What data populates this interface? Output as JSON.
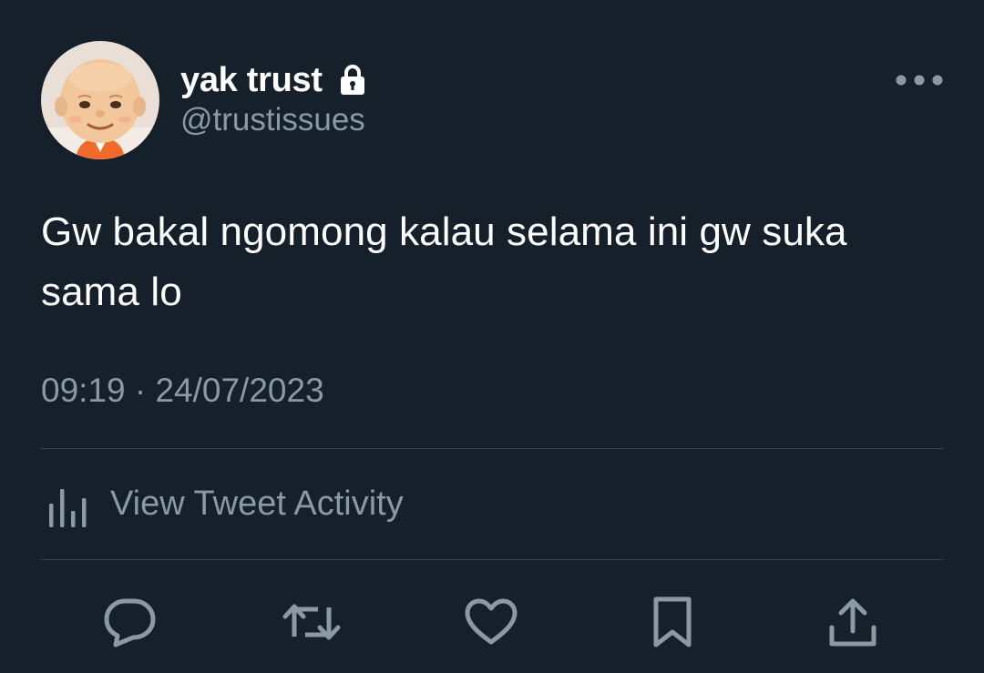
{
  "tweet": {
    "display_name": "yak trust",
    "handle": "@trustissues",
    "protected_icon": "lock-icon",
    "text": "Gw bakal ngomong kalau selama ini gw suka sama lo",
    "timestamp": "09:19 · 24/07/2023",
    "activity_label": "View Tweet Activity",
    "more_icon": "more-horizontal-icon"
  },
  "actions": [
    {
      "name": "reply",
      "icon": "reply-icon"
    },
    {
      "name": "retweet",
      "icon": "retweet-icon"
    },
    {
      "name": "like",
      "icon": "heart-icon"
    },
    {
      "name": "bookmark",
      "icon": "bookmark-icon"
    },
    {
      "name": "share",
      "icon": "share-icon"
    }
  ],
  "colors": {
    "background": "#15202b",
    "primary_text": "#ffffff",
    "secondary_text": "#8b98a5",
    "divider": "#38444d"
  }
}
